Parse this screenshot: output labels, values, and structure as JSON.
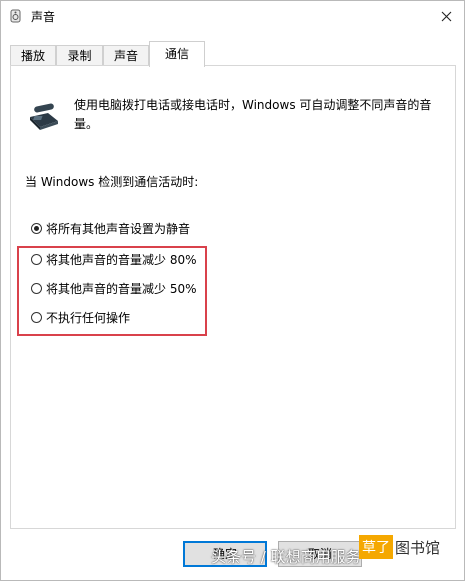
{
  "window": {
    "title": "声音"
  },
  "tabs": [
    {
      "label": "播放"
    },
    {
      "label": "录制"
    },
    {
      "label": "声音"
    },
    {
      "label": "通信"
    }
  ],
  "active_tab": "通信",
  "panel": {
    "description": "使用电脑拨打电话或接电话时，Windows 可自动调整不同声音的音量。",
    "section_label": "当 Windows 检测到通信活动时:",
    "options": [
      {
        "label": "将所有其他声音设置为静音",
        "checked": true
      },
      {
        "label": "将其他声音的音量减少 80%",
        "checked": false
      },
      {
        "label": "将其他声音的音量减少 50%",
        "checked": false
      },
      {
        "label": "不执行任何操作",
        "checked": false
      }
    ]
  },
  "buttons": {
    "ok": "确定",
    "cancel": "取消"
  },
  "watermark": {
    "text": "头条号 / 联想商用服务",
    "logo_part1": "草了",
    "logo_part2": "图书馆"
  },
  "colors": {
    "highlight": "#d9414b",
    "default_button_border": "#0078d7",
    "logo": "#f5a800"
  }
}
